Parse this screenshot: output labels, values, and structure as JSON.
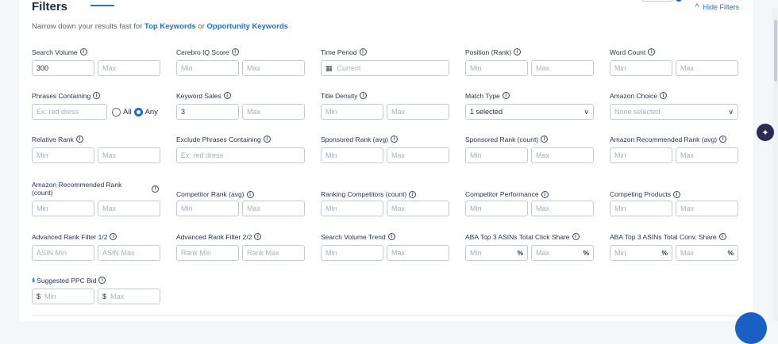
{
  "header": {
    "title": "Filters",
    "hide_filters": "Hide Filters",
    "subtitle_prefix": "Narrow down your results fast for ",
    "subtitle_link1": "Top Keywords",
    "subtitle_mid": " or ",
    "subtitle_link2": "Opportunity Keywords"
  },
  "icons": {
    "info": "i",
    "chevron_up": "^",
    "dropdown": "∨",
    "calendar": "▦",
    "ppc": "ılı"
  },
  "fields": {
    "search_volume": {
      "label": "Search Volume",
      "min": "300",
      "max": "Max"
    },
    "cerebro_iq": {
      "label": "Cerebro IQ Score",
      "min": "Min",
      "max": "Max"
    },
    "time_period": {
      "label": "Time Period",
      "value": "Current"
    },
    "position_rank": {
      "label": "Position (Rank)",
      "min": "Min",
      "max": "Max"
    },
    "word_count": {
      "label": "Word Count",
      "min": "Min",
      "max": "Max"
    },
    "phrases_containing": {
      "label": "Phrases Containing",
      "placeholder": "Ex: red dress",
      "opt_all": "All",
      "opt_any": "Any"
    },
    "keyword_sales": {
      "label": "Keyword Sales",
      "min": "3",
      "max": "Max"
    },
    "title_density": {
      "label": "Title Density",
      "min": "Min",
      "max": "Max"
    },
    "match_type": {
      "label": "Match Type",
      "value": "1 selected"
    },
    "amazon_choice": {
      "label": "Amazon Choice",
      "value": "None selected"
    },
    "relative_rank": {
      "label": "Relative Rank",
      "min": "Min",
      "max": "Max"
    },
    "exclude_phrases": {
      "label": "Exclude Phrases Containing",
      "placeholder": "Ex: red dress"
    },
    "sponsored_rank_avg": {
      "label": "Sponsored Rank (avg)",
      "min": "Min",
      "max": "Max"
    },
    "sponsored_rank_count": {
      "label": "Sponsored Rank (count)",
      "min": "Min",
      "max": "Max"
    },
    "amazon_rec_rank_avg": {
      "label": "Amazon Recommended Rank (avg)",
      "min": "Min",
      "max": "Max"
    },
    "amazon_rec_rank_count": {
      "label": "Amazon Recommended Rank (count)",
      "min": "Min",
      "max": "Max"
    },
    "competitor_rank_avg": {
      "label": "Competitor Rank (avg)",
      "min": "Min",
      "max": "Max"
    },
    "ranking_competitors": {
      "label": "Ranking Competitors (count)",
      "min": "Min",
      "max": "Max"
    },
    "competitor_performance": {
      "label": "Competitor Performance",
      "min": "Min",
      "max": "Max"
    },
    "competing_products": {
      "label": "Competing Products",
      "min": "Min",
      "max": "Max"
    },
    "adv_rank_1": {
      "label": "Advanced Rank Filter 1/2",
      "min": "ASIN Min",
      "max": "ASIN Max"
    },
    "adv_rank_2": {
      "label": "Advanced Rank Filter 2/2",
      "min": "Rank Min",
      "max": "Rank Max"
    },
    "sv_trend": {
      "label": "Search Volume Trend",
      "min": "Min",
      "max": "Max"
    },
    "aba_click": {
      "label": "ABA Top 3 ASINs Total Click Share",
      "min": "Min",
      "max": "Max",
      "unit": "%"
    },
    "aba_conv": {
      "label": "ABA Top 3 ASINs Total Conv. Share",
      "min": "Min",
      "max": "Max",
      "unit": "%"
    },
    "ppc_bid": {
      "label": "Suggested PPC Bid",
      "min": "Min",
      "max": "Max",
      "currency": "$"
    }
  }
}
